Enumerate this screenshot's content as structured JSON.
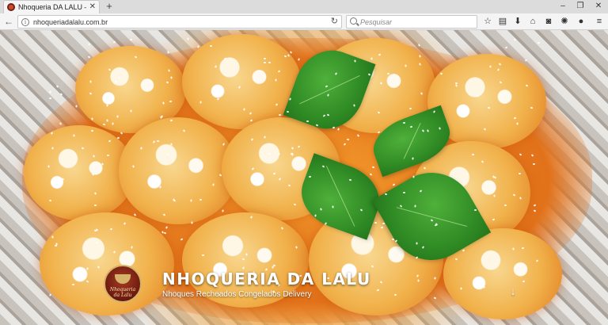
{
  "browser": {
    "tab_title": "Nhoqueria DA LALU – Nhoq",
    "tab_close": "✕",
    "new_tab": "+",
    "window_controls": {
      "minimize": "–",
      "maximize": "❐",
      "close": "✕"
    },
    "url": "nhoqueriadalalu.com.br",
    "search_placeholder": "Pesquisar",
    "toolbar_icons": [
      "star-icon",
      "reader-icon",
      "download-icon",
      "home-icon",
      "pocket-icon",
      "extension-icon",
      "addon-icon",
      "menu-icon"
    ]
  },
  "hero": {
    "logo_text": "Nhoqueria da Lalu",
    "title": "NHOQUERIA DA LALU",
    "subtitle": "Nhoques Recheados Congelados Delivery",
    "scroll_arrow": "↓"
  },
  "colors": {
    "sauce": "#e2721a",
    "basil": "#2f8a24",
    "logo": "#6b1a0f"
  }
}
